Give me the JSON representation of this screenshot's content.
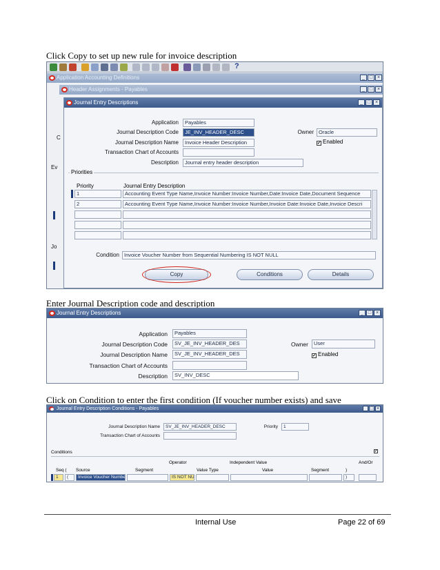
{
  "captions": {
    "step1": "Click Copy to set up new rule for invoice description",
    "step2": "Enter Journal Description code and description",
    "step3": "Click on Condition to enter the first condition (If voucher number exists) and save"
  },
  "shot1": {
    "bg_windows": {
      "app_title": "Application Accounting Definitions",
      "header_title": "Header Assignments - Payables"
    },
    "left_stubs": [
      "C",
      "Ev",
      "Jo"
    ],
    "window_title": "Journal Entry Descriptions",
    "labels": {
      "application": "Application",
      "code": "Journal Description Code",
      "name": "Journal Description Name",
      "coa": "Transaction Chart of Accounts",
      "description": "Description",
      "owner": "Owner",
      "enabled": "Enabled",
      "priorities": "Priorities",
      "priority_col": "Priority",
      "jed_col": "Journal Entry Description",
      "condition": "Condition"
    },
    "values": {
      "application": "Payables",
      "code": "JE_INV_HEADER_DESC",
      "name": "Invoice Header Description",
      "coa": "",
      "description": "Journal entry header description",
      "owner": "Oracle",
      "enabled_mark": "✔",
      "condition": "Invoice Voucher Number from Sequential Numbering IS NOT NULL"
    },
    "rows": [
      {
        "priority": "1",
        "desc": "Accounting Event Type Name,Invoice Number:Invoice Number,Date:Invoice Date,Document Sequence"
      },
      {
        "priority": "2",
        "desc": "Accounting Event Type Name,Invoice Number:Invoice Number,Invoice Date:Invoice Date,Invoice Descri"
      }
    ],
    "buttons": {
      "copy": "Copy",
      "conditions": "Conditions",
      "details": "Details"
    }
  },
  "shot2": {
    "window_title": "Journal Entry Descriptions",
    "labels": {
      "application": "Application",
      "code": "Journal Description Code",
      "name": "Journal Description Name",
      "coa": "Transaction Chart of Accounts",
      "description": "Description",
      "owner": "Owner",
      "enabled": "Enabled"
    },
    "values": {
      "application": "Payables",
      "code": "SV_JE_INV_HEADER_DES",
      "name": "SV_JE_INV_HEADER_DES",
      "coa": "",
      "description": "SV_INV_DESC",
      "owner": "User",
      "enabled_mark": "✔"
    }
  },
  "shot3": {
    "window_title": "Journal Entry Description Conditions - Payables",
    "labels": {
      "name": "Journal Description Name",
      "coa": "Transaction Chart of Accounts",
      "priority": "Priority",
      "conditions": "Conditions",
      "operator": "Operator",
      "independent_value": "Independent Value",
      "andor": "And/Or",
      "seq": "Seq (",
      "source": "Source",
      "segment": "Segment",
      "value_type": "Value Type",
      "value": "Value",
      "segment2": "Segment",
      "close_paren": ")"
    },
    "values": {
      "name": "SV_JE_INV_HEADER_DESC",
      "priority": "1",
      "checkbox_mark": "✔",
      "row_seq": "1",
      "row_open": "(",
      "row_source": "Invoice Voucher Number",
      "row_operator": "IS NOT NUL",
      "row_close": ")"
    }
  },
  "footer": {
    "center": "Internal Use",
    "page": "Page 22 of 69"
  }
}
